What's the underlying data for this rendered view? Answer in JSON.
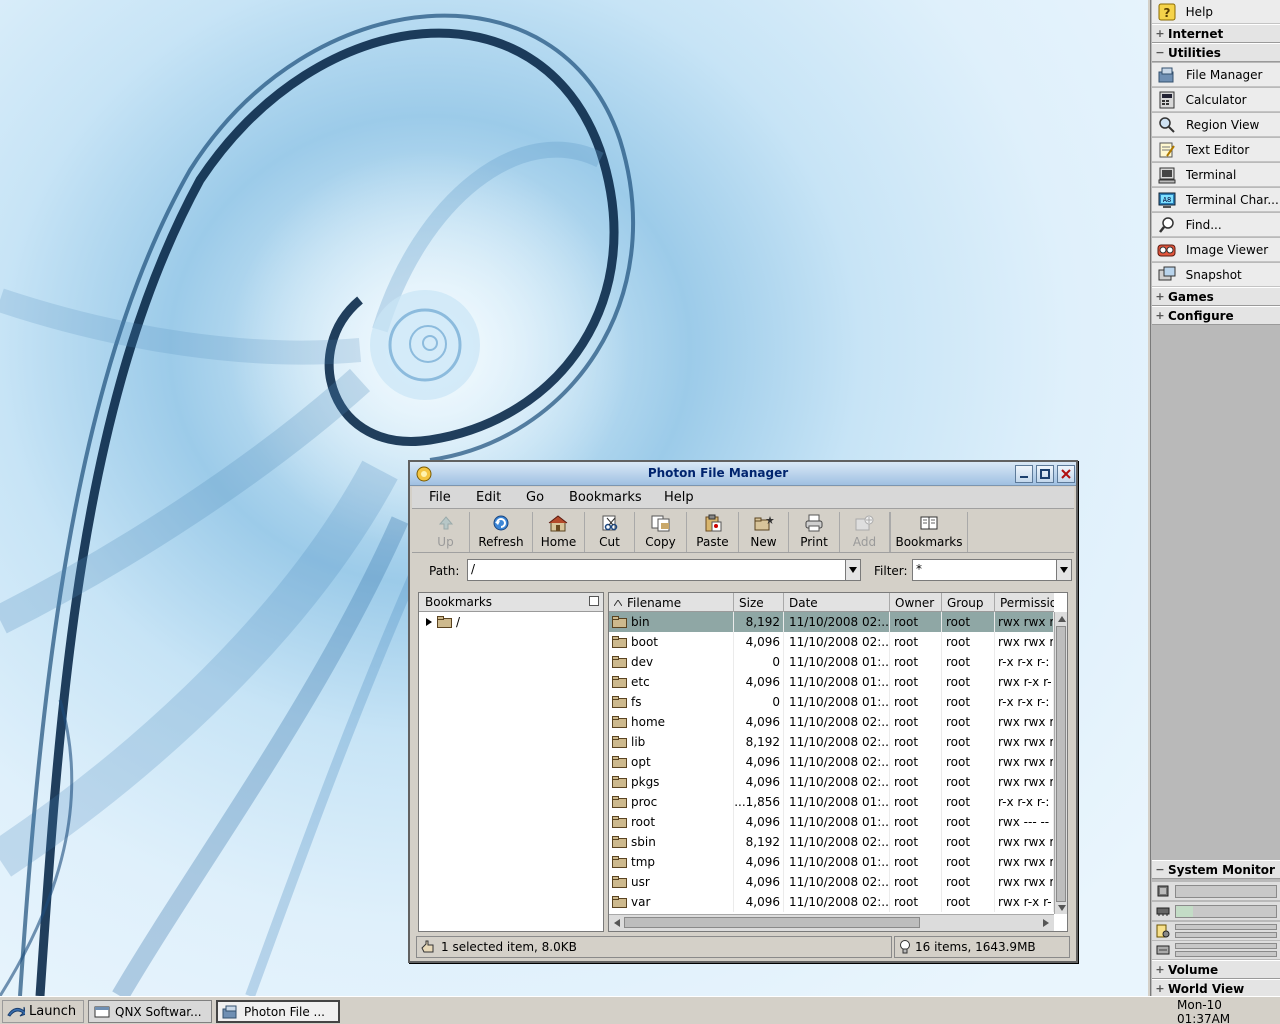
{
  "shelf": {
    "top_items": [
      {
        "label": "Help",
        "icon": "help-icon"
      }
    ],
    "groups": {
      "internet": {
        "label": "Internet",
        "expanded": false
      },
      "utilities": {
        "label": "Utilities",
        "expanded": true
      },
      "games": {
        "label": "Games",
        "expanded": false
      },
      "configure": {
        "label": "Configure",
        "expanded": false
      },
      "system_monitor": {
        "label": "System Monitor",
        "expanded": true
      },
      "volume": {
        "label": "Volume",
        "expanded": false
      },
      "world_view": {
        "label": "World View",
        "expanded": false
      }
    },
    "utilities": [
      {
        "label": "File Manager",
        "icon": "file-manager-icon"
      },
      {
        "label": "Calculator",
        "icon": "calculator-icon"
      },
      {
        "label": "Region View",
        "icon": "region-view-icon"
      },
      {
        "label": "Text Editor",
        "icon": "text-editor-icon"
      },
      {
        "label": "Terminal",
        "icon": "terminal-icon"
      },
      {
        "label": "Terminal Char...",
        "icon": "terminal-char-icon"
      },
      {
        "label": "Find...",
        "icon": "find-icon"
      },
      {
        "label": "Image Viewer",
        "icon": "image-viewer-icon"
      },
      {
        "label": "Snapshot",
        "icon": "snapshot-icon"
      }
    ],
    "monitor": {
      "cpu_load": 0.0,
      "memory_used": 0.17
    }
  },
  "taskbar": {
    "launch": "Launch",
    "tasks": [
      {
        "label": "QNX Softwar...",
        "active": false
      },
      {
        "label": "Photon File ...",
        "active": true
      }
    ],
    "clock": "Mon-10 01:37AM"
  },
  "window": {
    "title": "Photon File Manager",
    "menus": [
      "File",
      "Edit",
      "Go",
      "Bookmarks",
      "Help"
    ],
    "toolbar": [
      {
        "label": "Up",
        "icon": "up-arrow-icon",
        "enabled": false
      },
      {
        "label": "Refresh",
        "icon": "refresh-icon",
        "enabled": true
      },
      {
        "label": "Home",
        "icon": "home-icon",
        "enabled": true
      },
      {
        "label": "Cut",
        "icon": "cut-icon",
        "enabled": true
      },
      {
        "label": "Copy",
        "icon": "copy-icon",
        "enabled": true
      },
      {
        "label": "Paste",
        "icon": "paste-icon",
        "enabled": true
      },
      {
        "label": "New",
        "icon": "new-folder-icon",
        "enabled": true
      },
      {
        "label": "Print",
        "icon": "print-icon",
        "enabled": true
      },
      {
        "label": "Add",
        "icon": "add-icon",
        "enabled": false
      },
      {
        "label": "Bookmarks",
        "icon": "bookmarks-icon",
        "enabled": true
      }
    ],
    "path_label": "Path:",
    "path_value": "/",
    "filter_label": "Filter:",
    "filter_value": "*",
    "bookmarks": {
      "header": "Bookmarks",
      "root": "/"
    },
    "columns": [
      "Filename",
      "Size",
      "Date",
      "Owner",
      "Group",
      "Permissio"
    ],
    "files": [
      {
        "name": "bin",
        "size": "8,192",
        "date": "11/10/2008 02:...",
        "owner": "root",
        "group": "root",
        "perm": "rwx rwx r",
        "selected": true
      },
      {
        "name": "boot",
        "size": "4,096",
        "date": "11/10/2008 02:...",
        "owner": "root",
        "group": "root",
        "perm": "rwx rwx r",
        "selected": false
      },
      {
        "name": "dev",
        "size": "0",
        "date": "11/10/2008 01:...",
        "owner": "root",
        "group": "root",
        "perm": "r-x r-x r-:",
        "selected": false
      },
      {
        "name": "etc",
        "size": "4,096",
        "date": "11/10/2008 01:...",
        "owner": "root",
        "group": "root",
        "perm": "rwx r-x r-",
        "selected": false
      },
      {
        "name": "fs",
        "size": "0",
        "date": "11/10/2008 01:...",
        "owner": "root",
        "group": "root",
        "perm": "r-x r-x r-:",
        "selected": false
      },
      {
        "name": "home",
        "size": "4,096",
        "date": "11/10/2008 02:...",
        "owner": "root",
        "group": "root",
        "perm": "rwx rwx r",
        "selected": false
      },
      {
        "name": "lib",
        "size": "8,192",
        "date": "11/10/2008 02:...",
        "owner": "root",
        "group": "root",
        "perm": "rwx rwx r",
        "selected": false
      },
      {
        "name": "opt",
        "size": "4,096",
        "date": "11/10/2008 02:...",
        "owner": "root",
        "group": "root",
        "perm": "rwx rwx r",
        "selected": false
      },
      {
        "name": "pkgs",
        "size": "4,096",
        "date": "11/10/2008 02:...",
        "owner": "root",
        "group": "root",
        "perm": "rwx rwx r",
        "selected": false
      },
      {
        "name": "proc",
        "size": "...1,856",
        "date": "11/10/2008 01:...",
        "owner": "root",
        "group": "root",
        "perm": "r-x r-x r-:",
        "selected": false
      },
      {
        "name": "root",
        "size": "4,096",
        "date": "11/10/2008 01:...",
        "owner": "root",
        "group": "root",
        "perm": "rwx --- --",
        "selected": false
      },
      {
        "name": "sbin",
        "size": "8,192",
        "date": "11/10/2008 02:...",
        "owner": "root",
        "group": "root",
        "perm": "rwx rwx r",
        "selected": false
      },
      {
        "name": "tmp",
        "size": "4,096",
        "date": "11/10/2008 01:...",
        "owner": "root",
        "group": "root",
        "perm": "rwx rwx r",
        "selected": false
      },
      {
        "name": "usr",
        "size": "4,096",
        "date": "11/10/2008 02:...",
        "owner": "root",
        "group": "root",
        "perm": "rwx rwx r",
        "selected": false
      },
      {
        "name": "var",
        "size": "4,096",
        "date": "11/10/2008 02:...",
        "owner": "root",
        "group": "root",
        "perm": "rwx r-x r-",
        "selected": false
      }
    ],
    "status_selected": "1 selected item, 8.0KB",
    "status_total": "16 items, 1643.9MB"
  },
  "colors": {
    "accent": "#00246e",
    "selection": "#8fa7a5",
    "desktop": "#9ccbe9"
  }
}
